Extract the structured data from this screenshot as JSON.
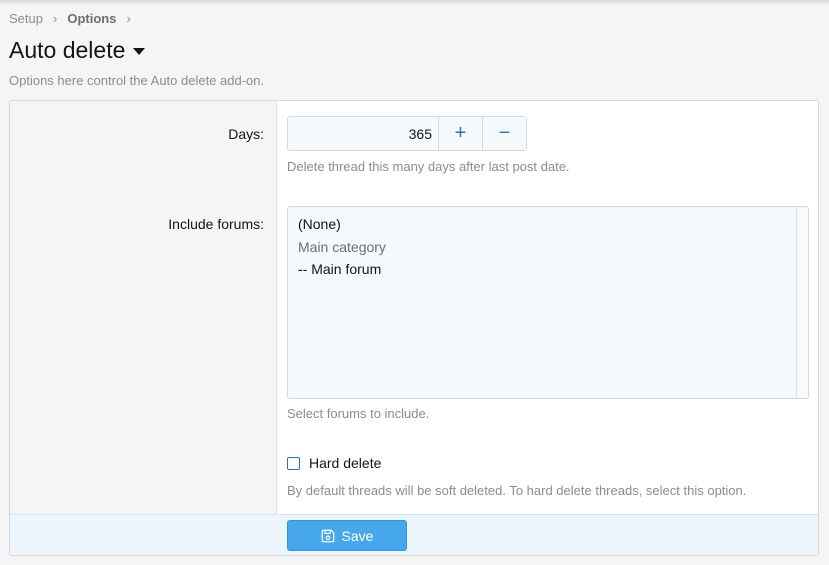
{
  "breadcrumb": {
    "items": [
      "Setup",
      "Options"
    ],
    "separator": "›"
  },
  "header": {
    "title": "Auto delete",
    "description": "Options here control the Auto delete add-on."
  },
  "days": {
    "label": "Days:",
    "value": "365",
    "increment": "+",
    "decrement": "−",
    "hint": "Delete thread this many days after last post date."
  },
  "forums": {
    "label": "Include forums:",
    "options": [
      "(None)",
      "Main category",
      "-- Main forum"
    ],
    "hint": "Select forums to include."
  },
  "hard_delete": {
    "label": "Hard delete",
    "checked": false,
    "hint": "By default threads will be soft deleted. To hard delete threads, select this option."
  },
  "footer": {
    "save_label": "Save",
    "save_icon": "floppy-disk-icon"
  },
  "colors": {
    "accent": "#47a7eb",
    "link": "#2577b1",
    "footer_bg": "#edf6fd"
  }
}
